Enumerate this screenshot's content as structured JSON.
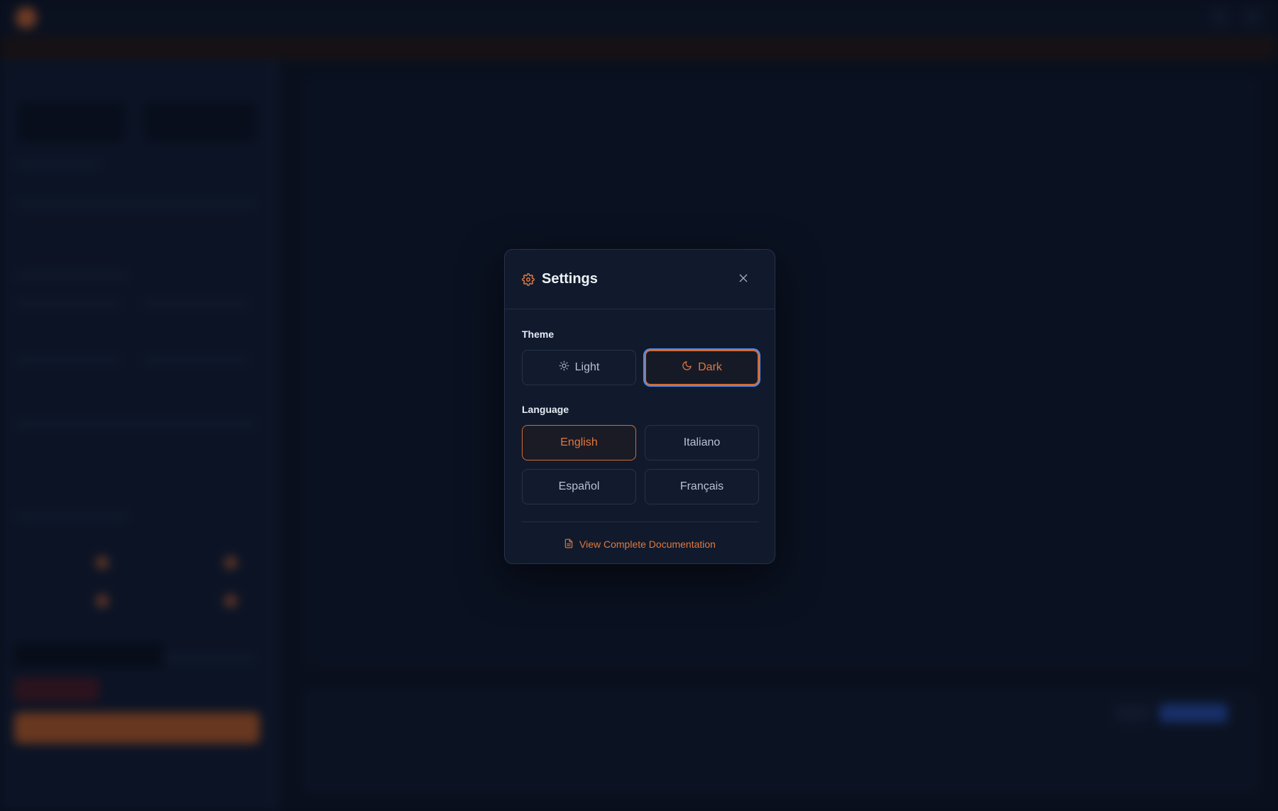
{
  "modal": {
    "title": "Settings",
    "icon": "gear-icon",
    "close_icon": "close-icon",
    "theme": {
      "label": "Theme",
      "options": [
        {
          "label": "Light",
          "icon": "sun-icon",
          "selected": false
        },
        {
          "label": "Dark",
          "icon": "moon-icon",
          "selected": true
        }
      ]
    },
    "language": {
      "label": "Language",
      "options": [
        {
          "label": "English",
          "selected": true
        },
        {
          "label": "Italiano",
          "selected": false
        },
        {
          "label": "Español",
          "selected": false
        },
        {
          "label": "Français",
          "selected": false
        }
      ]
    },
    "docs_link": {
      "label": "View Complete Documentation",
      "icon": "document-icon"
    }
  },
  "colors": {
    "accent": "#e0783f",
    "focus_ring": "#4c8ff0",
    "background": "#0d1526",
    "modal_bg": "#111a2c"
  }
}
